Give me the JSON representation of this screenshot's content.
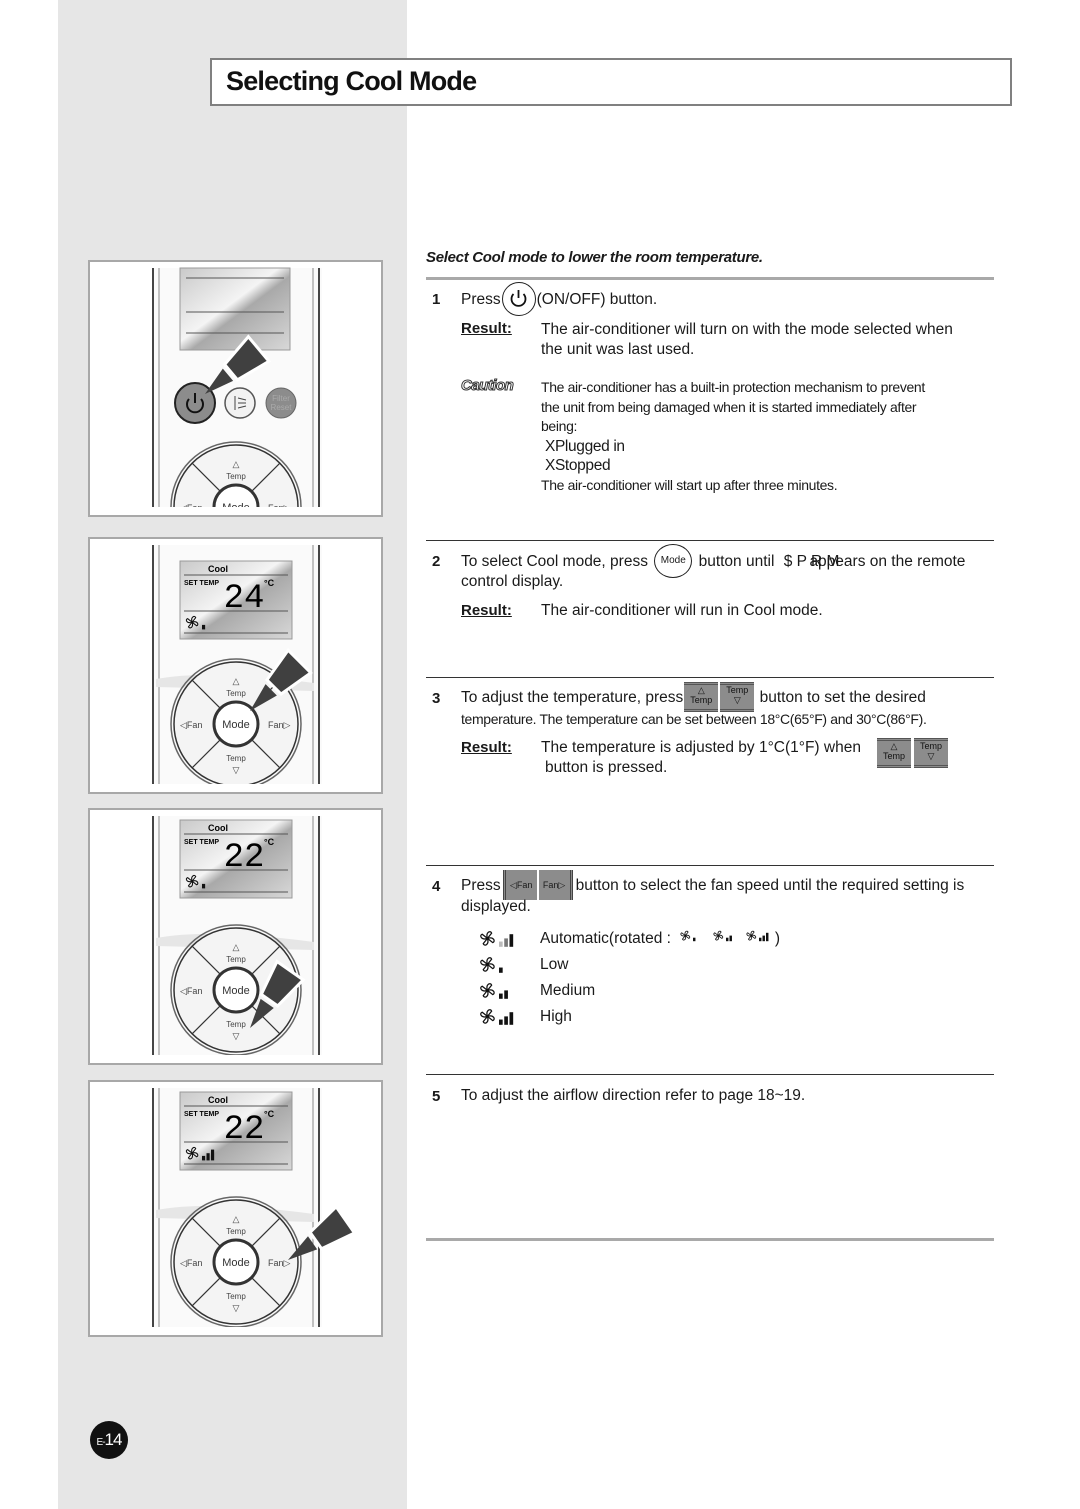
{
  "title": "Selecting Cool Mode",
  "intro": "Select Cool mode to lower the room temperature.",
  "result_label": "Result:",
  "caution_label": "Caution",
  "steps": {
    "s1": {
      "number": "1",
      "press": "Press",
      "after": "(ON/OFF) button.",
      "result_line1": "The air-conditioner will turn on with the mode selected when",
      "result_line2": "the unit was last used.",
      "caution_lines": [
        "The air-conditioner has a built-in protection mechanism to prevent",
        "the unit from being damaged when it is started immediately after",
        "being:",
        " XPlugged in",
        " XStopped",
        "The air-conditioner will start up after three minutes."
      ]
    },
    "s2": {
      "number": "2",
      "before": "To select Cool mode, press",
      "button_label": "Mode",
      "mid": "button until",
      "garbled": "$ P R M",
      "after": "appears on the remote",
      "line2": "control display.",
      "result": "The air-conditioner will run in Cool mode."
    },
    "s3": {
      "number": "3",
      "before": "To adjust the temperature, press",
      "button_label": "Temp",
      "after": "button to set the desired",
      "line2": "temperature. The temperature can be set between 18°C(65°F) and 30°C(86°F).",
      "result_line1": "The temperature is adjusted by 1°C(1°F) when",
      "result_line2": "button is pressed."
    },
    "s4": {
      "number": "4",
      "press": "Press",
      "button_label": "Fan",
      "after": "button to select the fan speed until the required setting is",
      "line2": "displayed.",
      "fan_speeds": [
        {
          "label": "Automatic(rotated :",
          "level": 3,
          "suffix": ")"
        },
        {
          "label": "Low",
          "level": 1
        },
        {
          "label": "Medium",
          "level": 2
        },
        {
          "label": "High",
          "level": 3
        }
      ]
    },
    "s5": {
      "number": "5",
      "text": "To adjust the airflow direction refer to page 18~19."
    }
  },
  "remotes": {
    "labels": {
      "temp": "Temp",
      "mode": "Mode",
      "fan": "Fan",
      "filter": "Filter",
      "reset": "Reset",
      "cool": "Cool",
      "set_temp": "SET TEMP",
      "unit": "°C"
    },
    "panels": [
      {
        "display": "blank",
        "highlight": "power"
      },
      {
        "display": "cool",
        "temp": "24",
        "fan_level": 1,
        "highlight": "mode"
      },
      {
        "display": "cool",
        "temp": "22",
        "fan_level": 1,
        "highlight": "temp-down"
      },
      {
        "display": "cool",
        "temp": "22",
        "fan_level": 3,
        "highlight": "fan-right"
      }
    ]
  },
  "page_number": {
    "prefix": "E-",
    "number": "14"
  },
  "colors": {
    "sidebar": "#e6e6e6",
    "button_gray": "#8c8c8c",
    "arrow": "#404040"
  }
}
